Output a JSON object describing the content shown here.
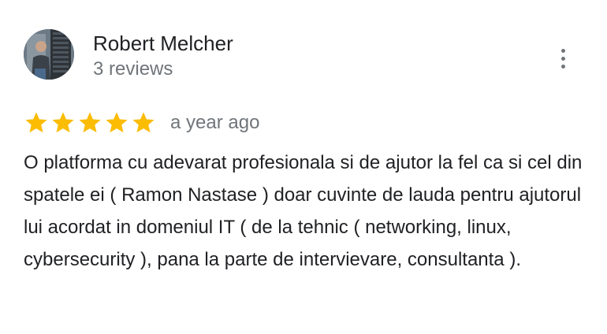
{
  "reviewer": {
    "name": "Robert Melcher",
    "review_count": "3 reviews",
    "avatar_icon": "user-avatar-photo"
  },
  "menu": {
    "icon": "more-vert-icon"
  },
  "review": {
    "rating": 5,
    "max_rating": 5,
    "date": "a year ago",
    "text": "O platforma cu adevarat profesionala si de ajutor la fel ca si cel din spatele ei ( Ramon Nastase ) doar cuvinte de lauda pentru ajutorul lui acordat in domeniul IT ( de la tehnic ( networking, linux, cybersecurity ), pana la parte de intervievare, consultanta )."
  },
  "colors": {
    "star": "#fbbc04",
    "text_primary": "#202124",
    "text_secondary": "#70757a"
  }
}
